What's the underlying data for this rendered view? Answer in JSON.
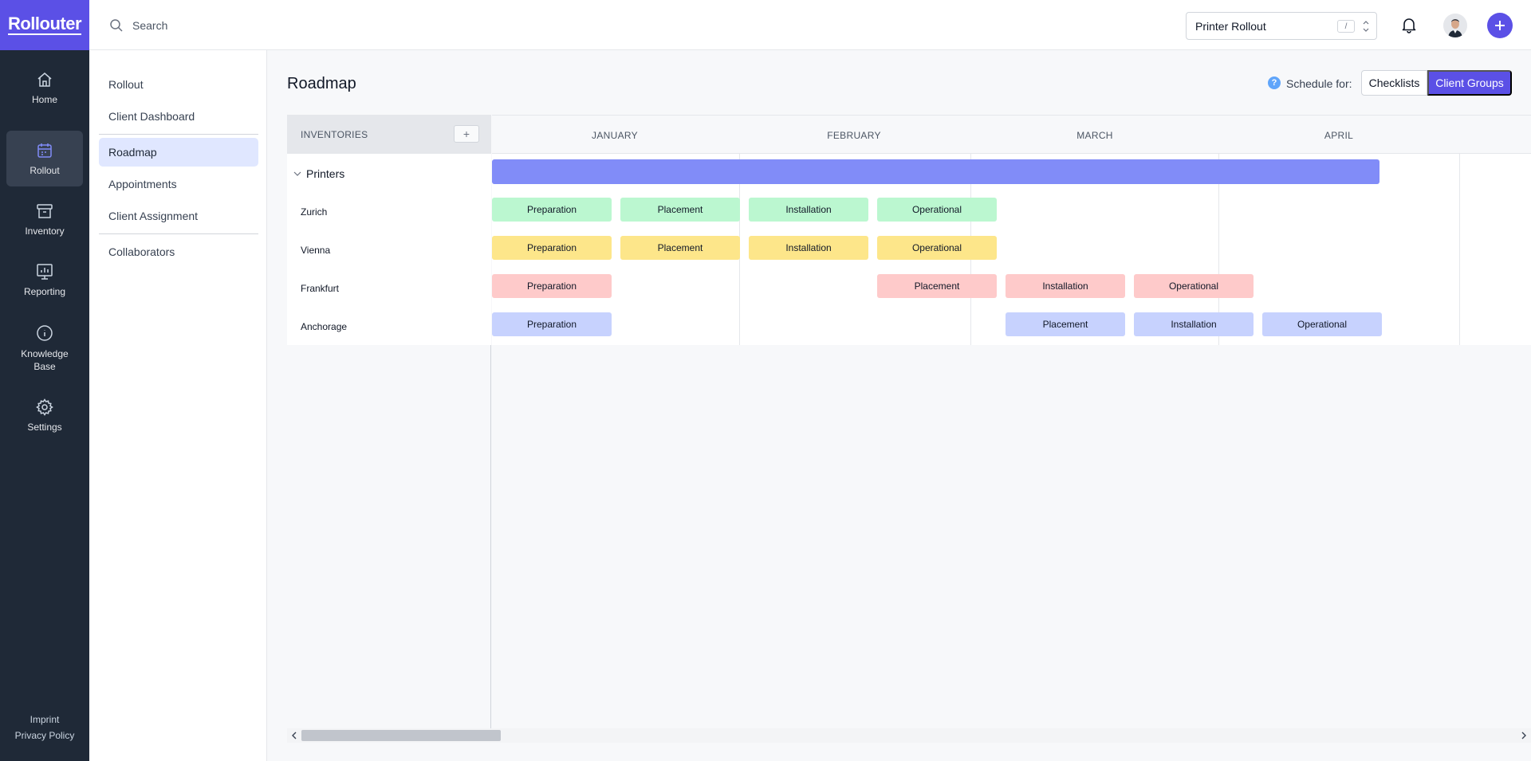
{
  "app": {
    "logo": "Rollouter"
  },
  "rail": {
    "items": [
      {
        "label": "Home",
        "icon": "home-icon"
      },
      {
        "label": "Rollout",
        "icon": "calendar-icon",
        "active": true
      },
      {
        "label": "Inventory",
        "icon": "archive-icon"
      },
      {
        "label": "Reporting",
        "icon": "chart-icon"
      },
      {
        "label": "Knowledge Base",
        "icon": "info-icon"
      },
      {
        "label": "Settings",
        "icon": "gear-icon"
      }
    ],
    "footer": {
      "imprint": "Imprint",
      "privacy": "Privacy Policy"
    }
  },
  "topbar": {
    "search_placeholder": "Search",
    "project": "Printer Rollout",
    "shortcut": "/"
  },
  "subnav": {
    "items": [
      {
        "label": "Rollout"
      },
      {
        "label": "Client Dashboard"
      },
      {
        "label": "Roadmap",
        "active": true
      },
      {
        "label": "Appointments"
      },
      {
        "label": "Client Assignment"
      },
      {
        "label": "Collaborators"
      }
    ]
  },
  "page": {
    "title": "Roadmap",
    "schedule_label": "Schedule for:",
    "help": "?",
    "toggle": {
      "checklists": "Checklists",
      "client_groups": "Client Groups",
      "selected": "Client Groups"
    }
  },
  "roadmap": {
    "inventories_header": "INVENTORIES",
    "add_symbol": "+",
    "months": [
      "JANUARY",
      "FEBRUARY",
      "MARCH",
      "APRIL"
    ],
    "group": "Printers",
    "colors": {
      "Zurich": "#bbf7d0",
      "Vienna": "#fde68a",
      "Frankfurt": "#fecaca",
      "Anchorage": "#c7d2fe",
      "summary": "#818cf8"
    },
    "rows": [
      {
        "name": "Zurich",
        "tasks": [
          {
            "label": "Preparation",
            "slot": 0
          },
          {
            "label": "Placement",
            "slot": 1
          },
          {
            "label": "Installation",
            "slot": 2
          },
          {
            "label": "Operational",
            "slot": 3
          }
        ]
      },
      {
        "name": "Vienna",
        "tasks": [
          {
            "label": "Preparation",
            "slot": 0
          },
          {
            "label": "Placement",
            "slot": 1
          },
          {
            "label": "Installation",
            "slot": 2
          },
          {
            "label": "Operational",
            "slot": 3
          }
        ]
      },
      {
        "name": "Frankfurt",
        "tasks": [
          {
            "label": "Preparation",
            "slot": 0
          },
          {
            "label": "Placement",
            "slot": 3
          },
          {
            "label": "Installation",
            "slot": 4
          },
          {
            "label": "Operational",
            "slot": 5
          }
        ]
      },
      {
        "name": "Anchorage",
        "tasks": [
          {
            "label": "Preparation",
            "slot": 0
          },
          {
            "label": "Placement",
            "slot": 4
          },
          {
            "label": "Installation",
            "slot": 5
          },
          {
            "label": "Operational",
            "slot": 6
          }
        ]
      }
    ]
  }
}
